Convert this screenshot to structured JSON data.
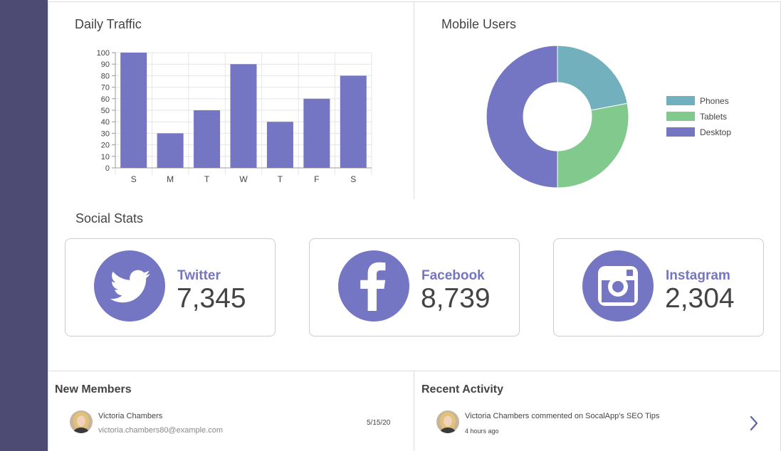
{
  "traffic": {
    "title": "Daily Traffic",
    "chart_data": {
      "type": "bar",
      "categories": [
        "S",
        "M",
        "T",
        "W",
        "T",
        "F",
        "S"
      ],
      "values": [
        100,
        30,
        50,
        90,
        40,
        60,
        80
      ],
      "ylim": [
        0,
        100
      ],
      "yticks": [
        0,
        10,
        20,
        30,
        40,
        50,
        60,
        70,
        80,
        90,
        100
      ],
      "grid": true,
      "color": "#7476c3"
    }
  },
  "mobile": {
    "title": "Mobile Users",
    "chart_data": {
      "type": "pie",
      "donut": true,
      "labels": [
        "Phones",
        "Tablets",
        "Desktop"
      ],
      "values": [
        22,
        28,
        50
      ],
      "colors": [
        "#73b0be",
        "#81c98c",
        "#7476c3"
      ],
      "legend_position": "right"
    }
  },
  "social": {
    "title": "Social Stats",
    "cards": [
      {
        "name": "Twitter",
        "count": "7,345",
        "icon": "twitter-icon"
      },
      {
        "name": "Facebook",
        "count": "8,739",
        "icon": "facebook-icon"
      },
      {
        "name": "Instagram",
        "count": "2,304",
        "icon": "instagram-icon"
      }
    ],
    "accent": "#7476c3"
  },
  "members": {
    "title": "New Members",
    "items": [
      {
        "name": "Victoria Chambers",
        "email": "victoria.chambers80@example.com",
        "date": "5/15/20"
      }
    ]
  },
  "activity": {
    "title": "Recent Activity",
    "items": [
      {
        "text": "Victoria Chambers commented on SocalApp's SEO Tips",
        "time": "4 hours ago"
      }
    ]
  }
}
